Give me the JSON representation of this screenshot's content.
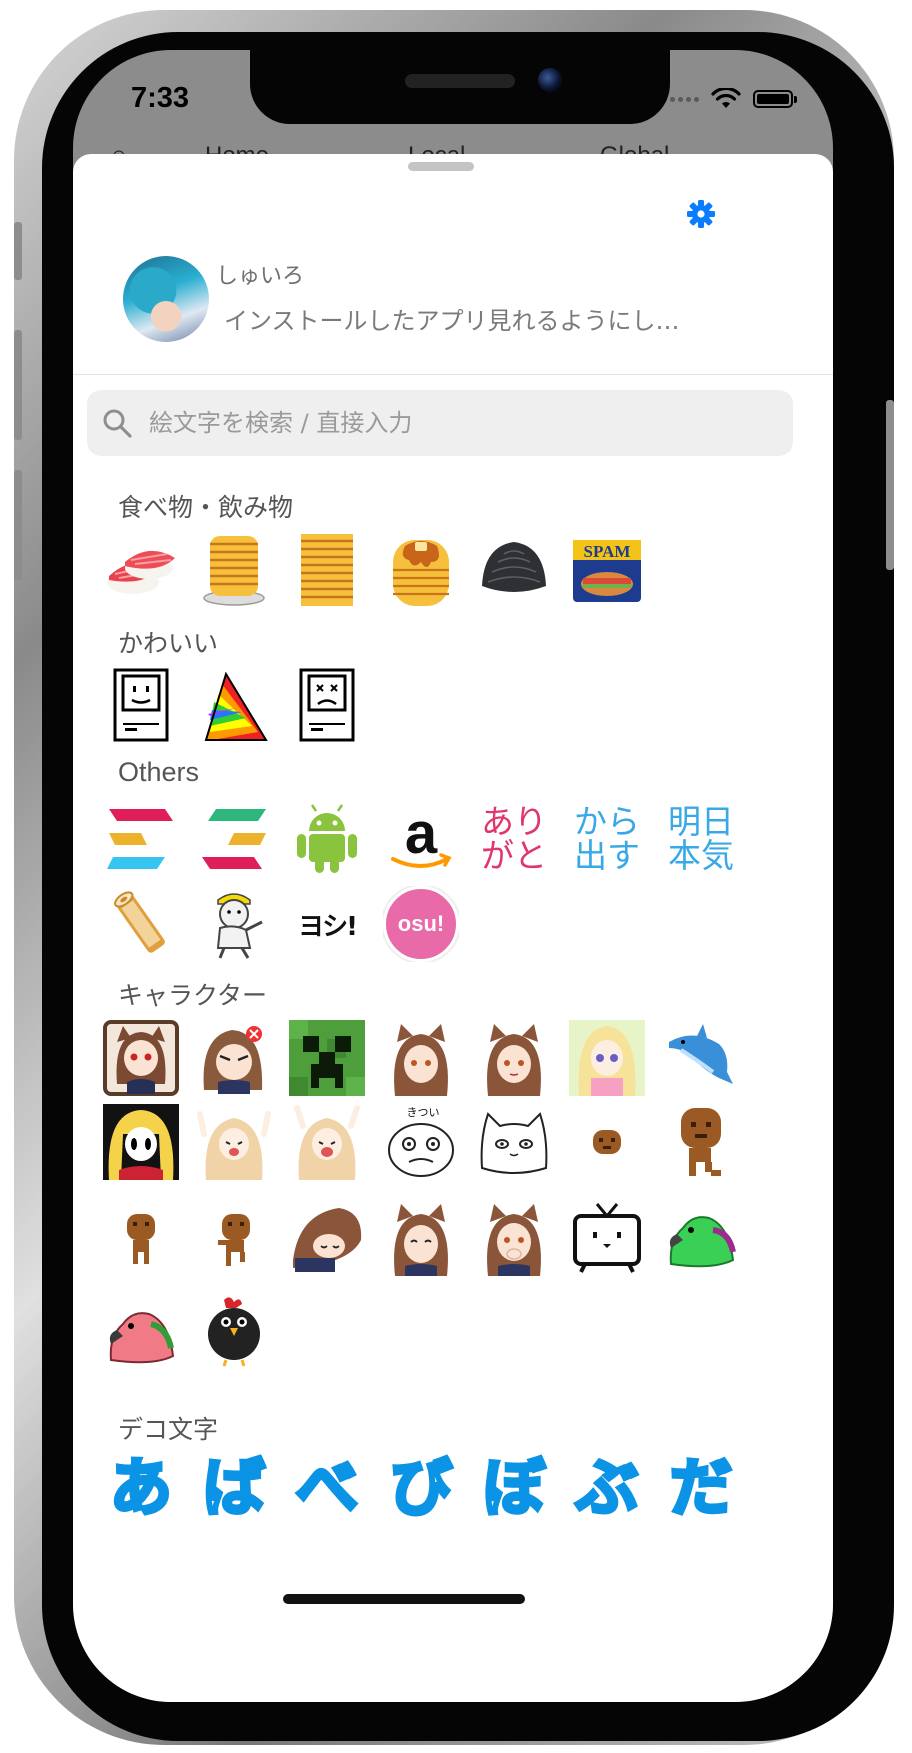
{
  "status_bar": {
    "time": "7:33"
  },
  "background_tabs": [
    "Home",
    "Local",
    "Global"
  ],
  "profile": {
    "name": "しゅいろ",
    "note": "インストールしたアプリ見れるようにし…"
  },
  "search": {
    "placeholder": "絵文字を検索 / 直接入力"
  },
  "categories": {
    "food": "食べ物・飲み物",
    "cute": "かわいい",
    "others": "Others",
    "characters": "キャラクター",
    "deco": "デコ文字"
  },
  "emoji_text": {
    "arigato_1": "あり",
    "arigato_2": "がと",
    "karadasu_1": "から",
    "karadasu_2": "出す",
    "ashita_1": "明日",
    "ashita_2": "本気",
    "yoshi": "ヨシ!",
    "osu": "osu!",
    "spam": "SPAM",
    "kitsui": "きつい"
  },
  "deco_chars": [
    "あ",
    "ば",
    "べ",
    "び",
    "ぼ",
    "ぶ",
    "だ"
  ],
  "colors": {
    "accent": "#0a7cff",
    "deco_stroke": "#0b93e6",
    "arigato": "#e0366b",
    "karadasu": "#38a9e6",
    "osu": "#e96aa8"
  },
  "icons": {
    "settings": "gear-icon",
    "search": "magnifier-icon",
    "signal": "signal-dots-icon",
    "wifi": "wifi-icon",
    "battery": "battery-icon"
  }
}
